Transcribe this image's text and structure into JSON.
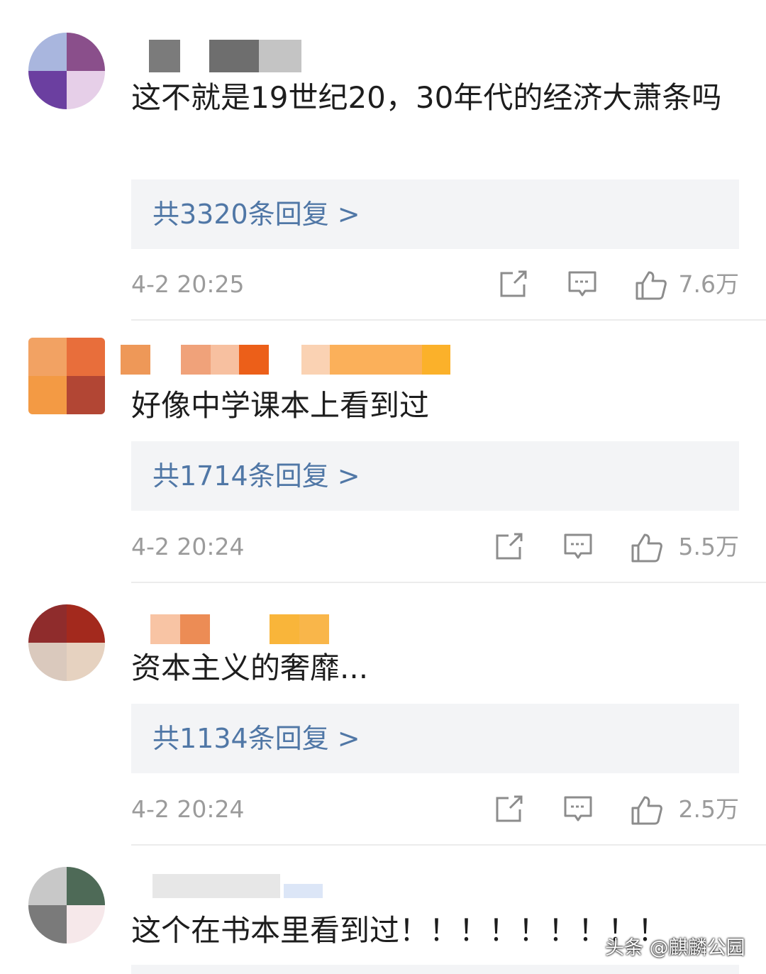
{
  "comments": [
    {
      "text": "这不就是19世纪20，30年代的经济大萧条吗",
      "reply_link": "共3320条回复 >",
      "time": "4-2 20:25",
      "likes": "7.6万"
    },
    {
      "text": "好像中学课本上看到过",
      "reply_link": "共1714条回复 >",
      "time": "4-2 20:24",
      "likes": "5.5万"
    },
    {
      "text": "资本主义的奢靡...",
      "reply_link": "共1134条回复 >",
      "time": "4-2 20:24",
      "likes": "2.5万"
    },
    {
      "text": "这个在书本里看到过！！！！！！！！！"
    }
  ],
  "watermark": "头条 @麒麟公园",
  "icons": [
    "share-icon",
    "comment-icon",
    "thumbs-up-icon"
  ],
  "colors": {
    "link": "#5077a6",
    "meta": "#9b9b9b",
    "reply_bg": "#f3f4f6",
    "text": "#1d1d1d"
  }
}
